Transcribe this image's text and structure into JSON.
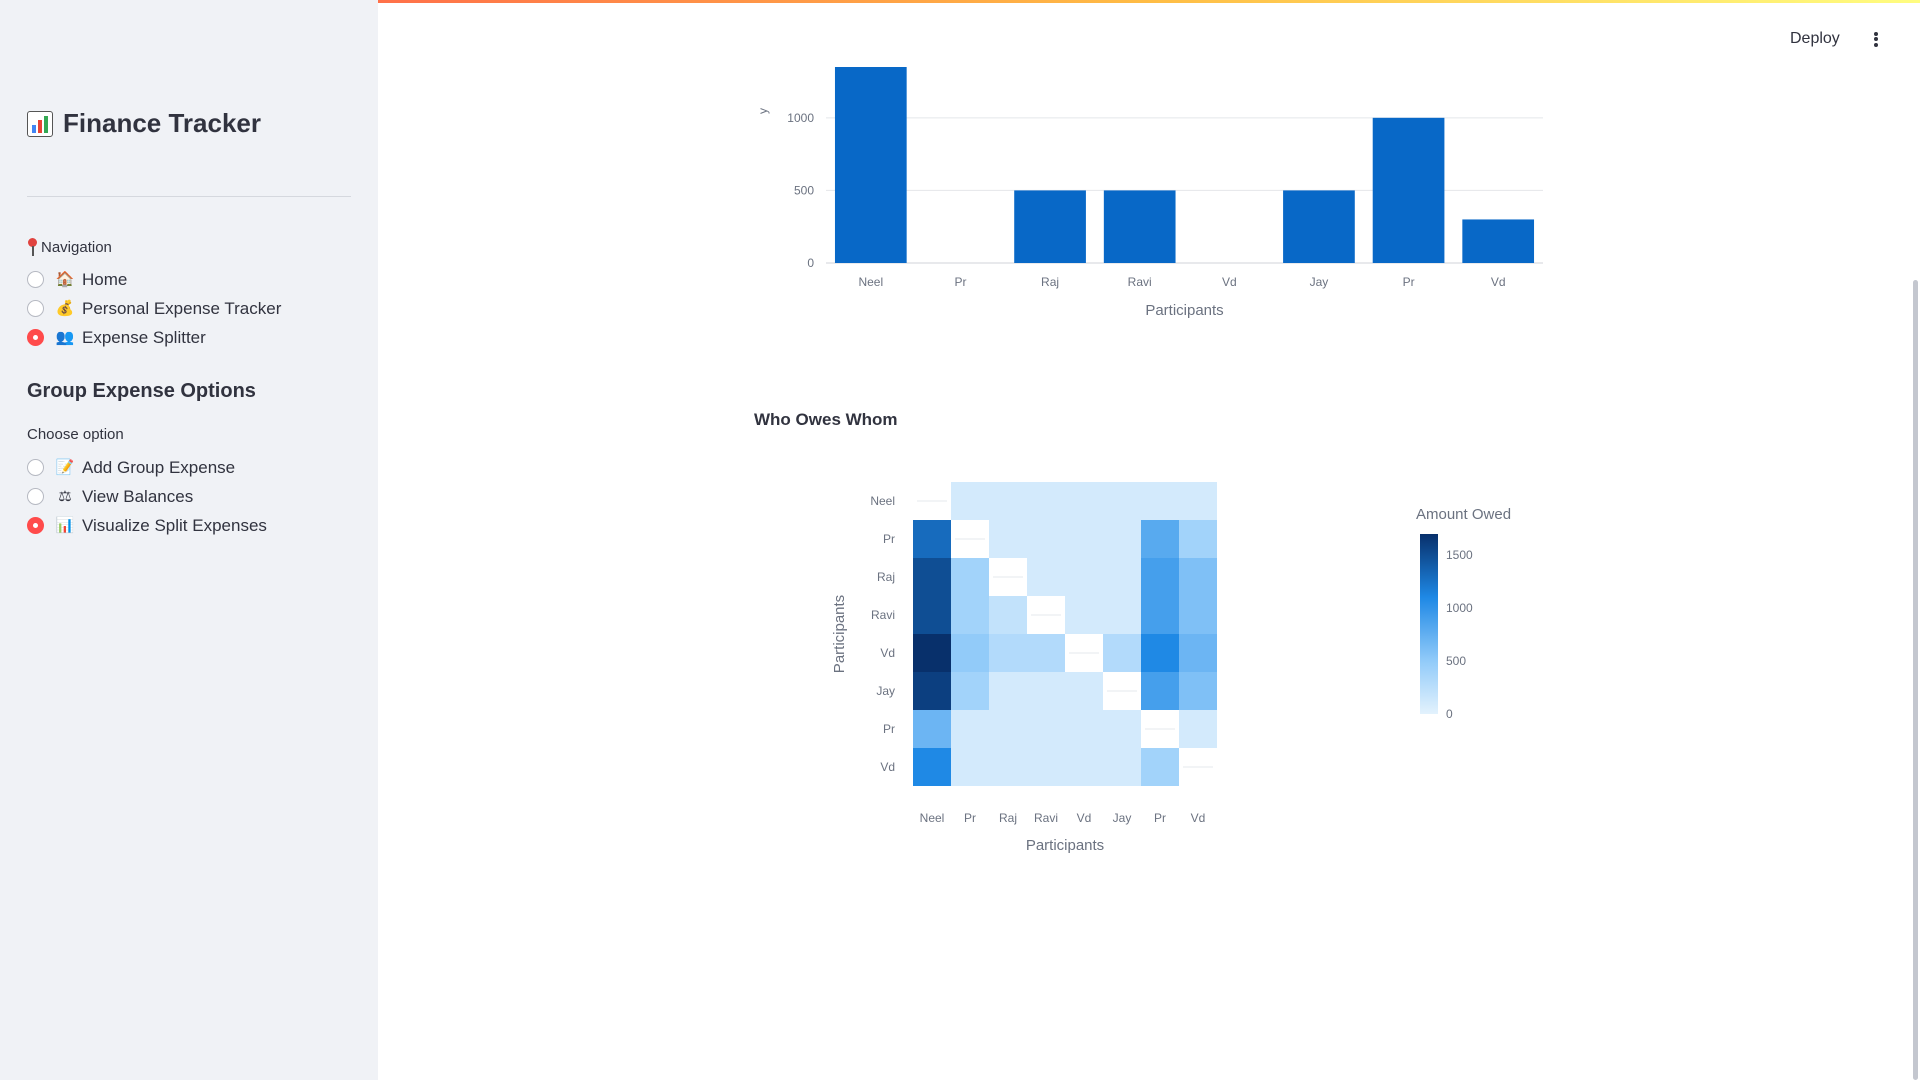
{
  "app": {
    "title": "Finance Tracker",
    "deploy_label": "Deploy"
  },
  "sidebar": {
    "title": "Finance Tracker",
    "navigation_label": "Navigation",
    "nav_items": [
      {
        "label": "Home",
        "icon": "house-icon",
        "selected": false
      },
      {
        "label": "Personal Expense Tracker",
        "icon": "money-bag-icon",
        "selected": false
      },
      {
        "label": "Expense Splitter",
        "icon": "people-icon",
        "selected": true
      }
    ],
    "section_title": "Group Expense Options",
    "choose_label": "Choose option",
    "options": [
      {
        "label": "Add Group Expense",
        "icon": "memo-icon",
        "selected": false
      },
      {
        "label": "View Balances",
        "icon": "scales-icon",
        "selected": false
      },
      {
        "label": "Visualize Split Expenses",
        "icon": "bar-chart-icon",
        "selected": true
      }
    ]
  },
  "colors": {
    "accent": "#ff4b4b",
    "bar": "#0868c7",
    "sidebar_bg": "#f0f2f6"
  },
  "chart_data": [
    {
      "type": "bar",
      "categories": [
        "Neel",
        "Pr",
        "Raj",
        "Ravi",
        "Vd",
        "Jay",
        "Pr",
        "Vd"
      ],
      "values": [
        1350,
        0,
        500,
        500,
        0,
        500,
        1000,
        300
      ],
      "title": "",
      "xlabel": "Participants",
      "ylabel": "y",
      "yticks": [
        0,
        500,
        1000
      ],
      "ylim": [
        0,
        1350
      ],
      "grid": true
    },
    {
      "type": "heatmap",
      "title": "Who Owes Whom",
      "xlabel": "Participants",
      "ylabel": "Participants",
      "x": [
        "Neel",
        "Pr",
        "Raj",
        "Ravi",
        "Vd",
        "Jay",
        "Pr",
        "Vd"
      ],
      "y": [
        "Neel",
        "Pr",
        "Raj",
        "Ravi",
        "Vd",
        "Jay",
        "Pr",
        "Vd"
      ],
      "colorbar_title": "Amount Owed",
      "colorbar_ticks": [
        0,
        500,
        1000,
        1500
      ],
      "zlim": [
        0,
        1700
      ],
      "z": [
        [
          0,
          100,
          100,
          100,
          100,
          100,
          100,
          100
        ],
        [
          1300,
          0,
          100,
          100,
          100,
          100,
          800,
          400
        ],
        [
          1500,
          400,
          0,
          100,
          100,
          100,
          900,
          600
        ],
        [
          1500,
          400,
          200,
          0,
          100,
          100,
          900,
          600
        ],
        [
          1700,
          500,
          300,
          300,
          0,
          300,
          1100,
          700
        ],
        [
          1600,
          400,
          100,
          100,
          100,
          0,
          900,
          600
        ],
        [
          700,
          100,
          100,
          100,
          100,
          100,
          0,
          100
        ],
        [
          1100,
          100,
          100,
          100,
          100,
          100,
          400,
          0
        ]
      ]
    }
  ]
}
